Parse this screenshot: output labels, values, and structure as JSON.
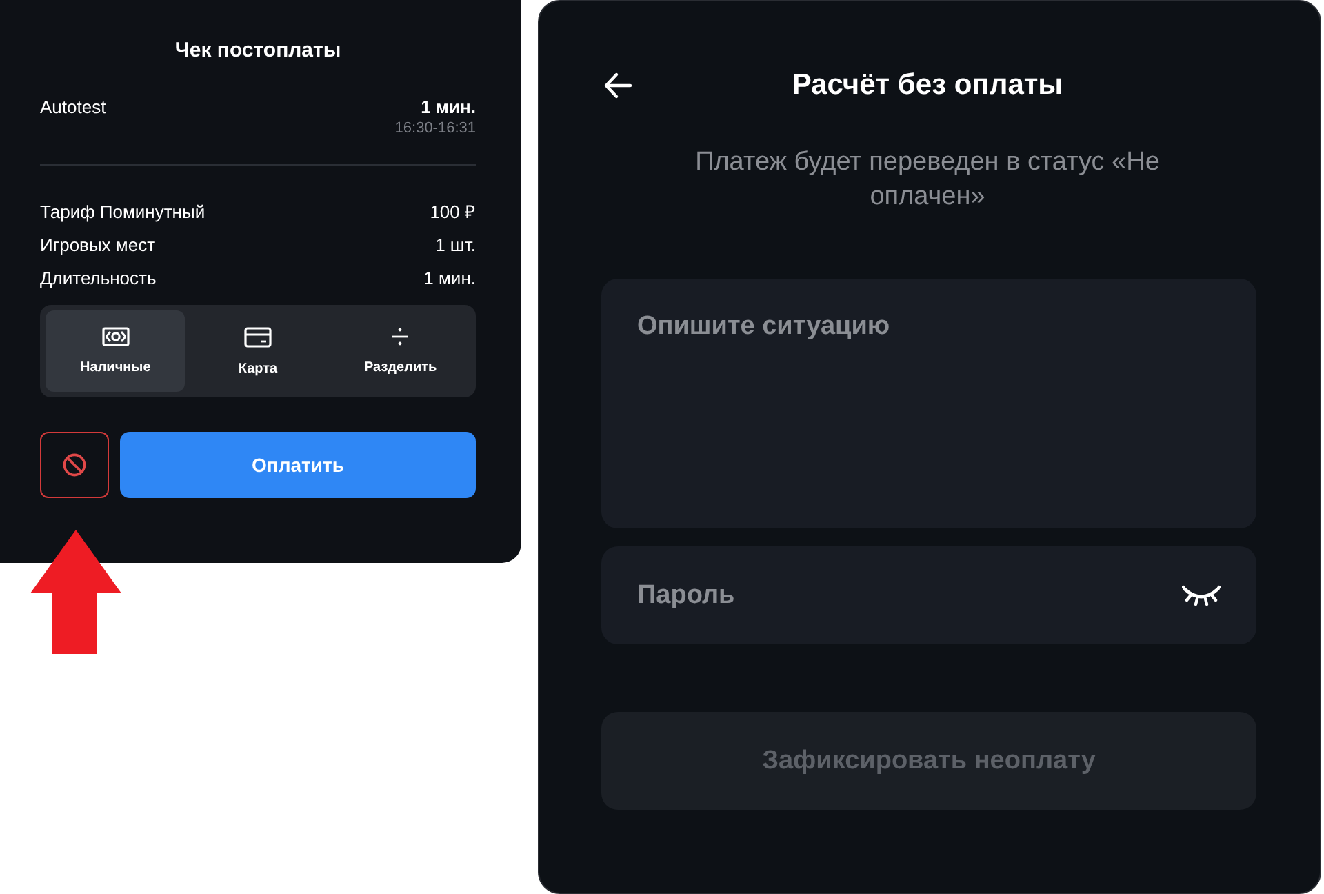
{
  "receipt": {
    "title": "Чек постоплаты",
    "session": {
      "name": "Autotest",
      "duration": "1 мин.",
      "time": "16:30-16:31"
    },
    "lines": [
      {
        "label": "Тариф Поминутный",
        "value": "100 ₽"
      },
      {
        "label": "Игровых мест",
        "value": "1 шт."
      },
      {
        "label": "Длительность",
        "value": "1 мин."
      }
    ],
    "payment_methods": [
      {
        "kind": "cash",
        "label": "Наличные",
        "selected": true
      },
      {
        "kind": "card",
        "label": "Карта",
        "selected": false
      },
      {
        "kind": "split",
        "label": "Разделить",
        "selected": false
      }
    ],
    "pay_button": "Оплатить"
  },
  "unpaid_dialog": {
    "title": "Расчёт без оплаты",
    "subtitle": "Платеж будет переведен в статус «Не оплачен»",
    "description_field": {
      "placeholder": "Опишите ситуацию"
    },
    "password_field": {
      "placeholder": "Пароль"
    },
    "submit_button": {
      "label": "Зафиксировать неоплату",
      "disabled": true
    }
  }
}
